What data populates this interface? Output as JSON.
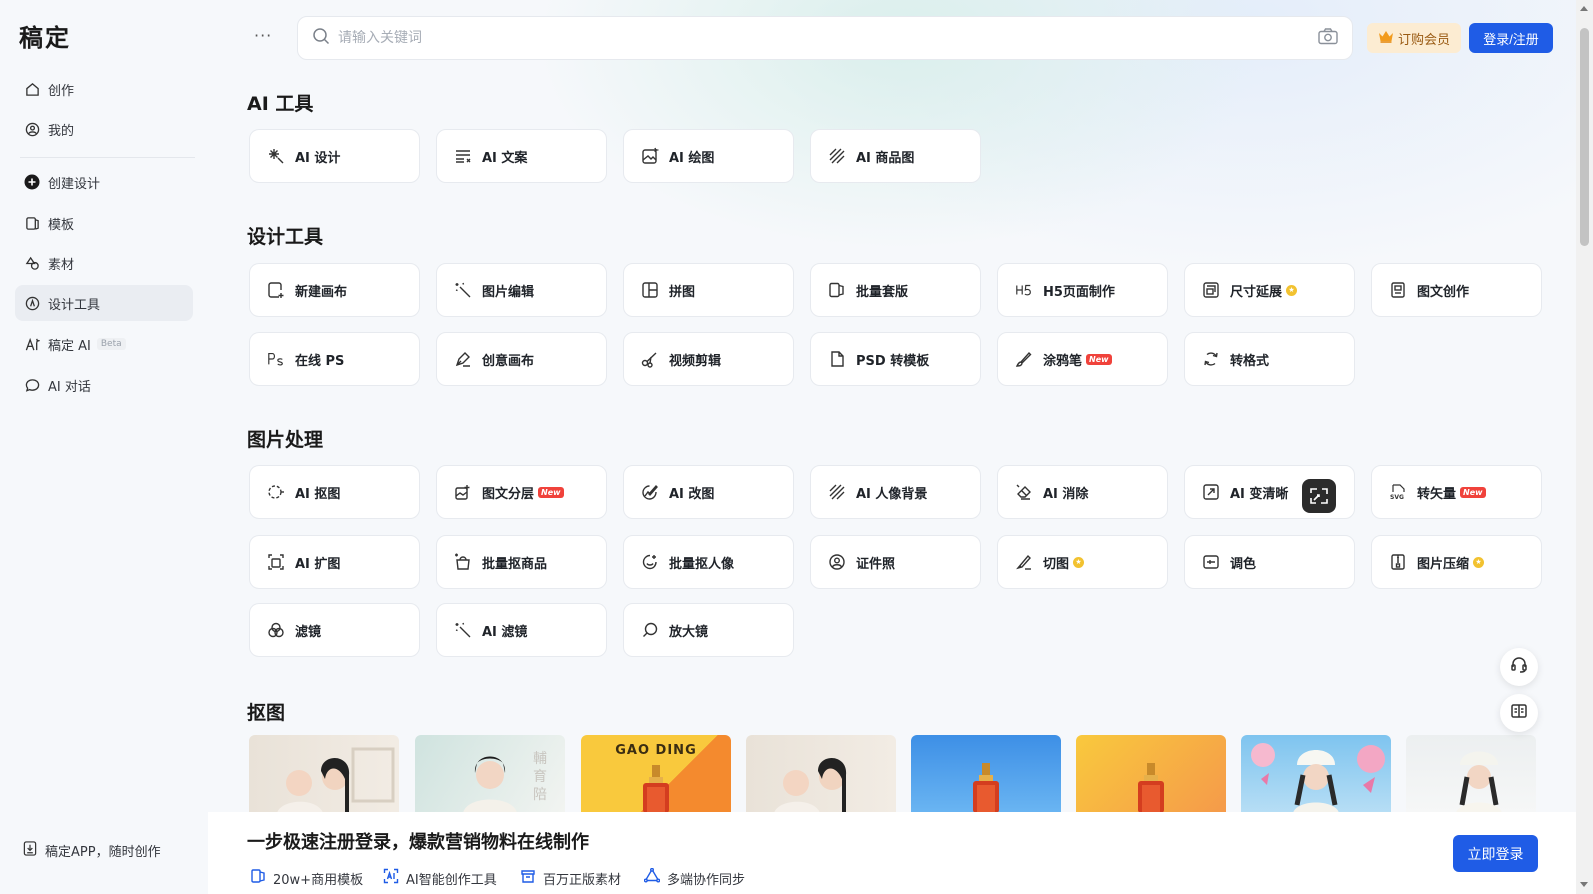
{
  "app": {
    "logo": "稿定"
  },
  "sidebar": {
    "items": [
      {
        "label": "创作",
        "icon": "home-icon"
      },
      {
        "label": "我的",
        "icon": "user-circle-icon"
      },
      {
        "label": "创建设计",
        "icon": "plus-circle-icon"
      },
      {
        "label": "模板",
        "icon": "template-icon"
      },
      {
        "label": "素材",
        "icon": "shapes-icon"
      },
      {
        "label": "设计工具",
        "icon": "compass-icon",
        "active": true
      },
      {
        "label": "稿定 AI",
        "icon": "ai-icon",
        "badge": "Beta"
      },
      {
        "label": "AI 对话",
        "icon": "chat-icon"
      }
    ],
    "app_link": "稿定APP，随时创作"
  },
  "header": {
    "more": "···",
    "search_placeholder": "请输入关键词",
    "vip_label": "订购会员",
    "login_label": "登录/注册"
  },
  "sections": {
    "ai_tools": {
      "title": "AI 工具",
      "items": [
        "AI 设计",
        "AI 文案",
        "AI 绘图",
        "AI 商品图"
      ]
    },
    "design_tools": {
      "title": "设计工具",
      "items": [
        "新建画布",
        "图片编辑",
        "拼图",
        "批量套版",
        "H5页面制作",
        "尺寸延展",
        "图文创作",
        "在线 PS",
        "创意画布",
        "视频剪辑",
        "PSD 转模板",
        "涂鸦笔",
        "转格式"
      ]
    },
    "image_processing": {
      "title": "图片处理",
      "items": [
        "AI 抠图",
        "图文分层",
        "AI 改图",
        "AI 人像背景",
        "AI 消除",
        "AI 变清晰",
        "转矢量",
        "AI 扩图",
        "批量抠商品",
        "批量抠人像",
        "证件照",
        "切图",
        "调色",
        "图片压缩",
        "滤镜",
        "AI 滤镜",
        "放大镜"
      ]
    },
    "cutout": {
      "title": "抠图",
      "thumb_label": "GAO DING"
    }
  },
  "badges": {
    "new": "New"
  },
  "banner": {
    "title": "一步极速注册登录，爆款营销物料在线制作",
    "features": [
      "20w+商用模板",
      "AI智能创作工具",
      "百万正版素材",
      "多端协作同步"
    ],
    "button": "立即登录"
  },
  "colors": {
    "primary": "#1f5ce6",
    "vip_bg": "#fcecd2",
    "new_badge": "#f0423b"
  }
}
